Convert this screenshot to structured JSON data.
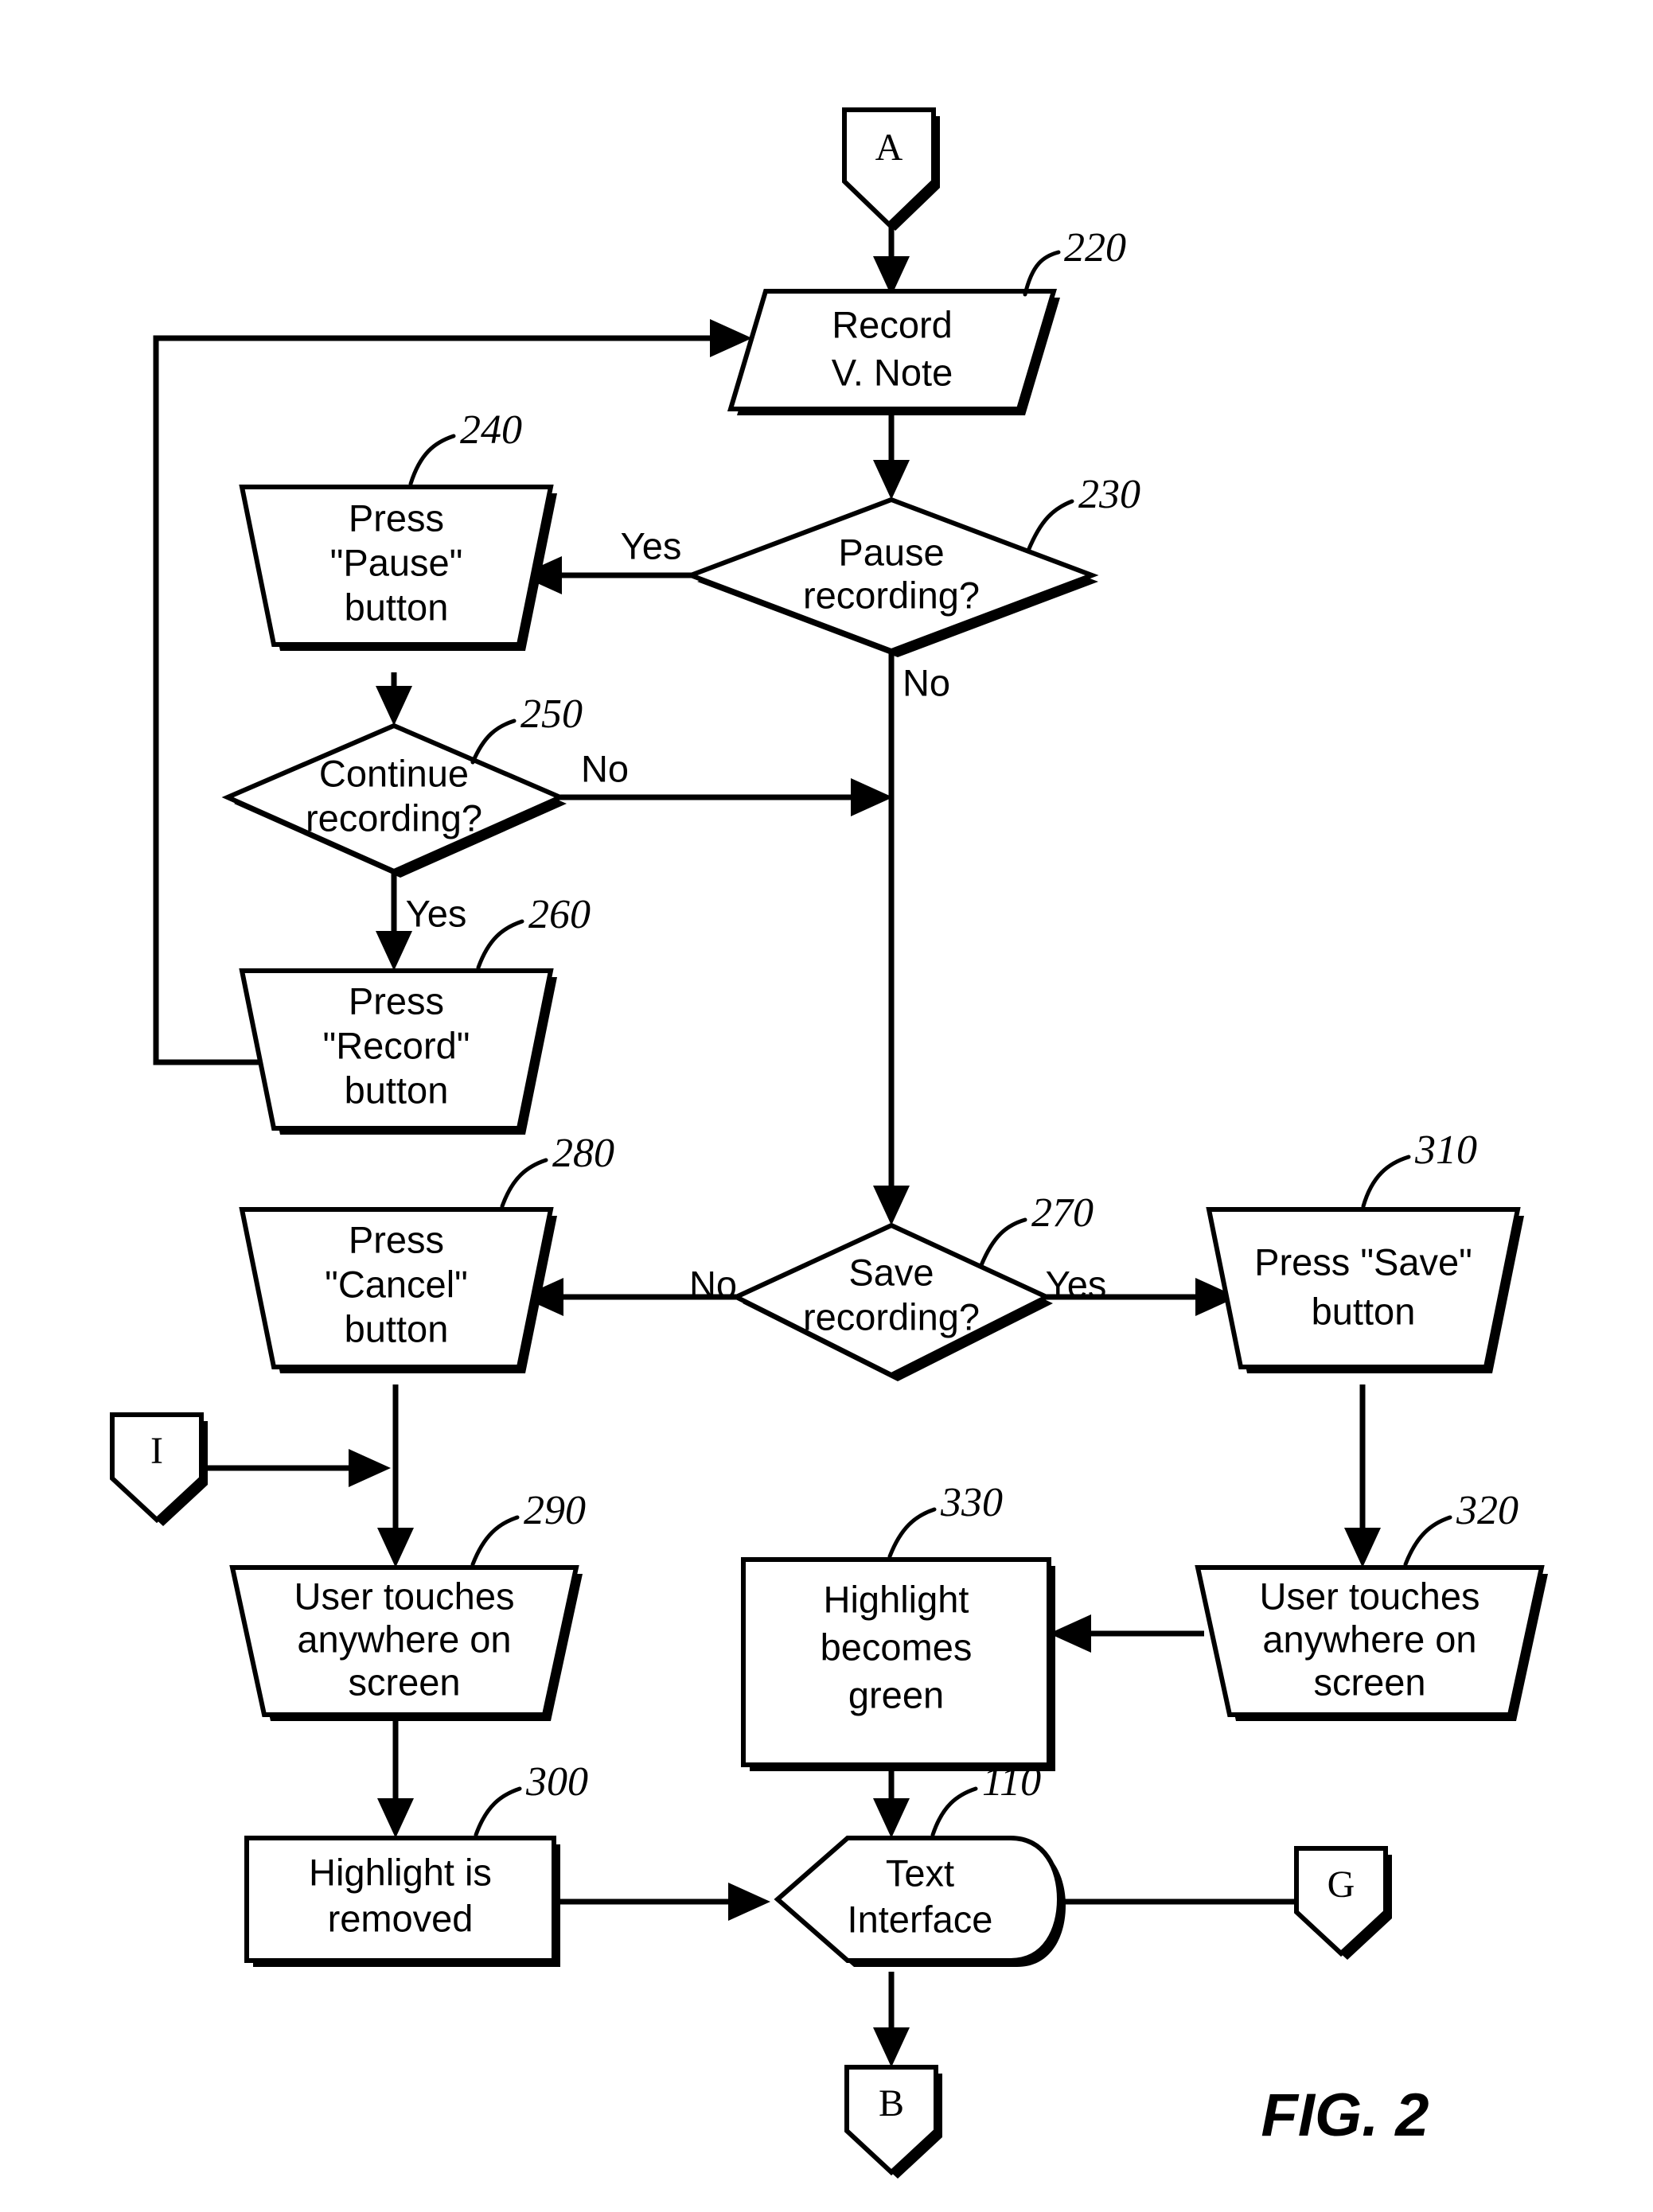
{
  "figure": {
    "caption": "FIG. 2"
  },
  "connectors": {
    "a": "A",
    "b": "B",
    "g": "G",
    "i": "I"
  },
  "nodes": [
    {
      "id": "220",
      "ref": "220",
      "shape": "parallelogram",
      "lines": [
        "Record",
        "V. Note"
      ]
    },
    {
      "id": "230",
      "ref": "230",
      "shape": "diamond",
      "lines": [
        "Pause",
        "recording?"
      ]
    },
    {
      "id": "240",
      "ref": "240",
      "shape": "trapezoid",
      "lines": [
        "Press",
        "\"Pause\"",
        "button"
      ]
    },
    {
      "id": "250",
      "ref": "250",
      "shape": "diamond",
      "lines": [
        "Continue",
        "recording?"
      ]
    },
    {
      "id": "260",
      "ref": "260",
      "shape": "trapezoid",
      "lines": [
        "Press",
        "\"Record\"",
        "button"
      ]
    },
    {
      "id": "270",
      "ref": "270",
      "shape": "diamond",
      "lines": [
        "Save",
        "recording?"
      ]
    },
    {
      "id": "280",
      "ref": "280",
      "shape": "trapezoid",
      "lines": [
        "Press",
        "\"Cancel\"",
        "button"
      ]
    },
    {
      "id": "290",
      "ref": "290",
      "shape": "trapezoid",
      "lines": [
        "User touches",
        "anywhere on",
        "screen"
      ]
    },
    {
      "id": "300",
      "ref": "300",
      "shape": "rectangle",
      "lines": [
        "Highlight is",
        "removed"
      ]
    },
    {
      "id": "310",
      "ref": "310",
      "shape": "trapezoid",
      "lines": [
        "Press \"Save\"",
        "button"
      ]
    },
    {
      "id": "320",
      "ref": "320",
      "shape": "trapezoid",
      "lines": [
        "User touches",
        "anywhere on",
        "screen"
      ]
    },
    {
      "id": "330",
      "ref": "330",
      "shape": "rectangle",
      "lines": [
        "Highlight",
        "becomes",
        "green"
      ]
    },
    {
      "id": "110",
      "ref": "110",
      "shape": "display",
      "lines": [
        "Text",
        "Interface"
      ]
    }
  ],
  "edge_labels": {
    "pause_yes": "Yes",
    "pause_no": "No",
    "continue_no": "No",
    "continue_yes": "Yes",
    "save_no": "No",
    "save_yes": "Yes"
  },
  "colors": {
    "stroke": "#000000",
    "fill": "#ffffff",
    "background": "#ffffff"
  }
}
